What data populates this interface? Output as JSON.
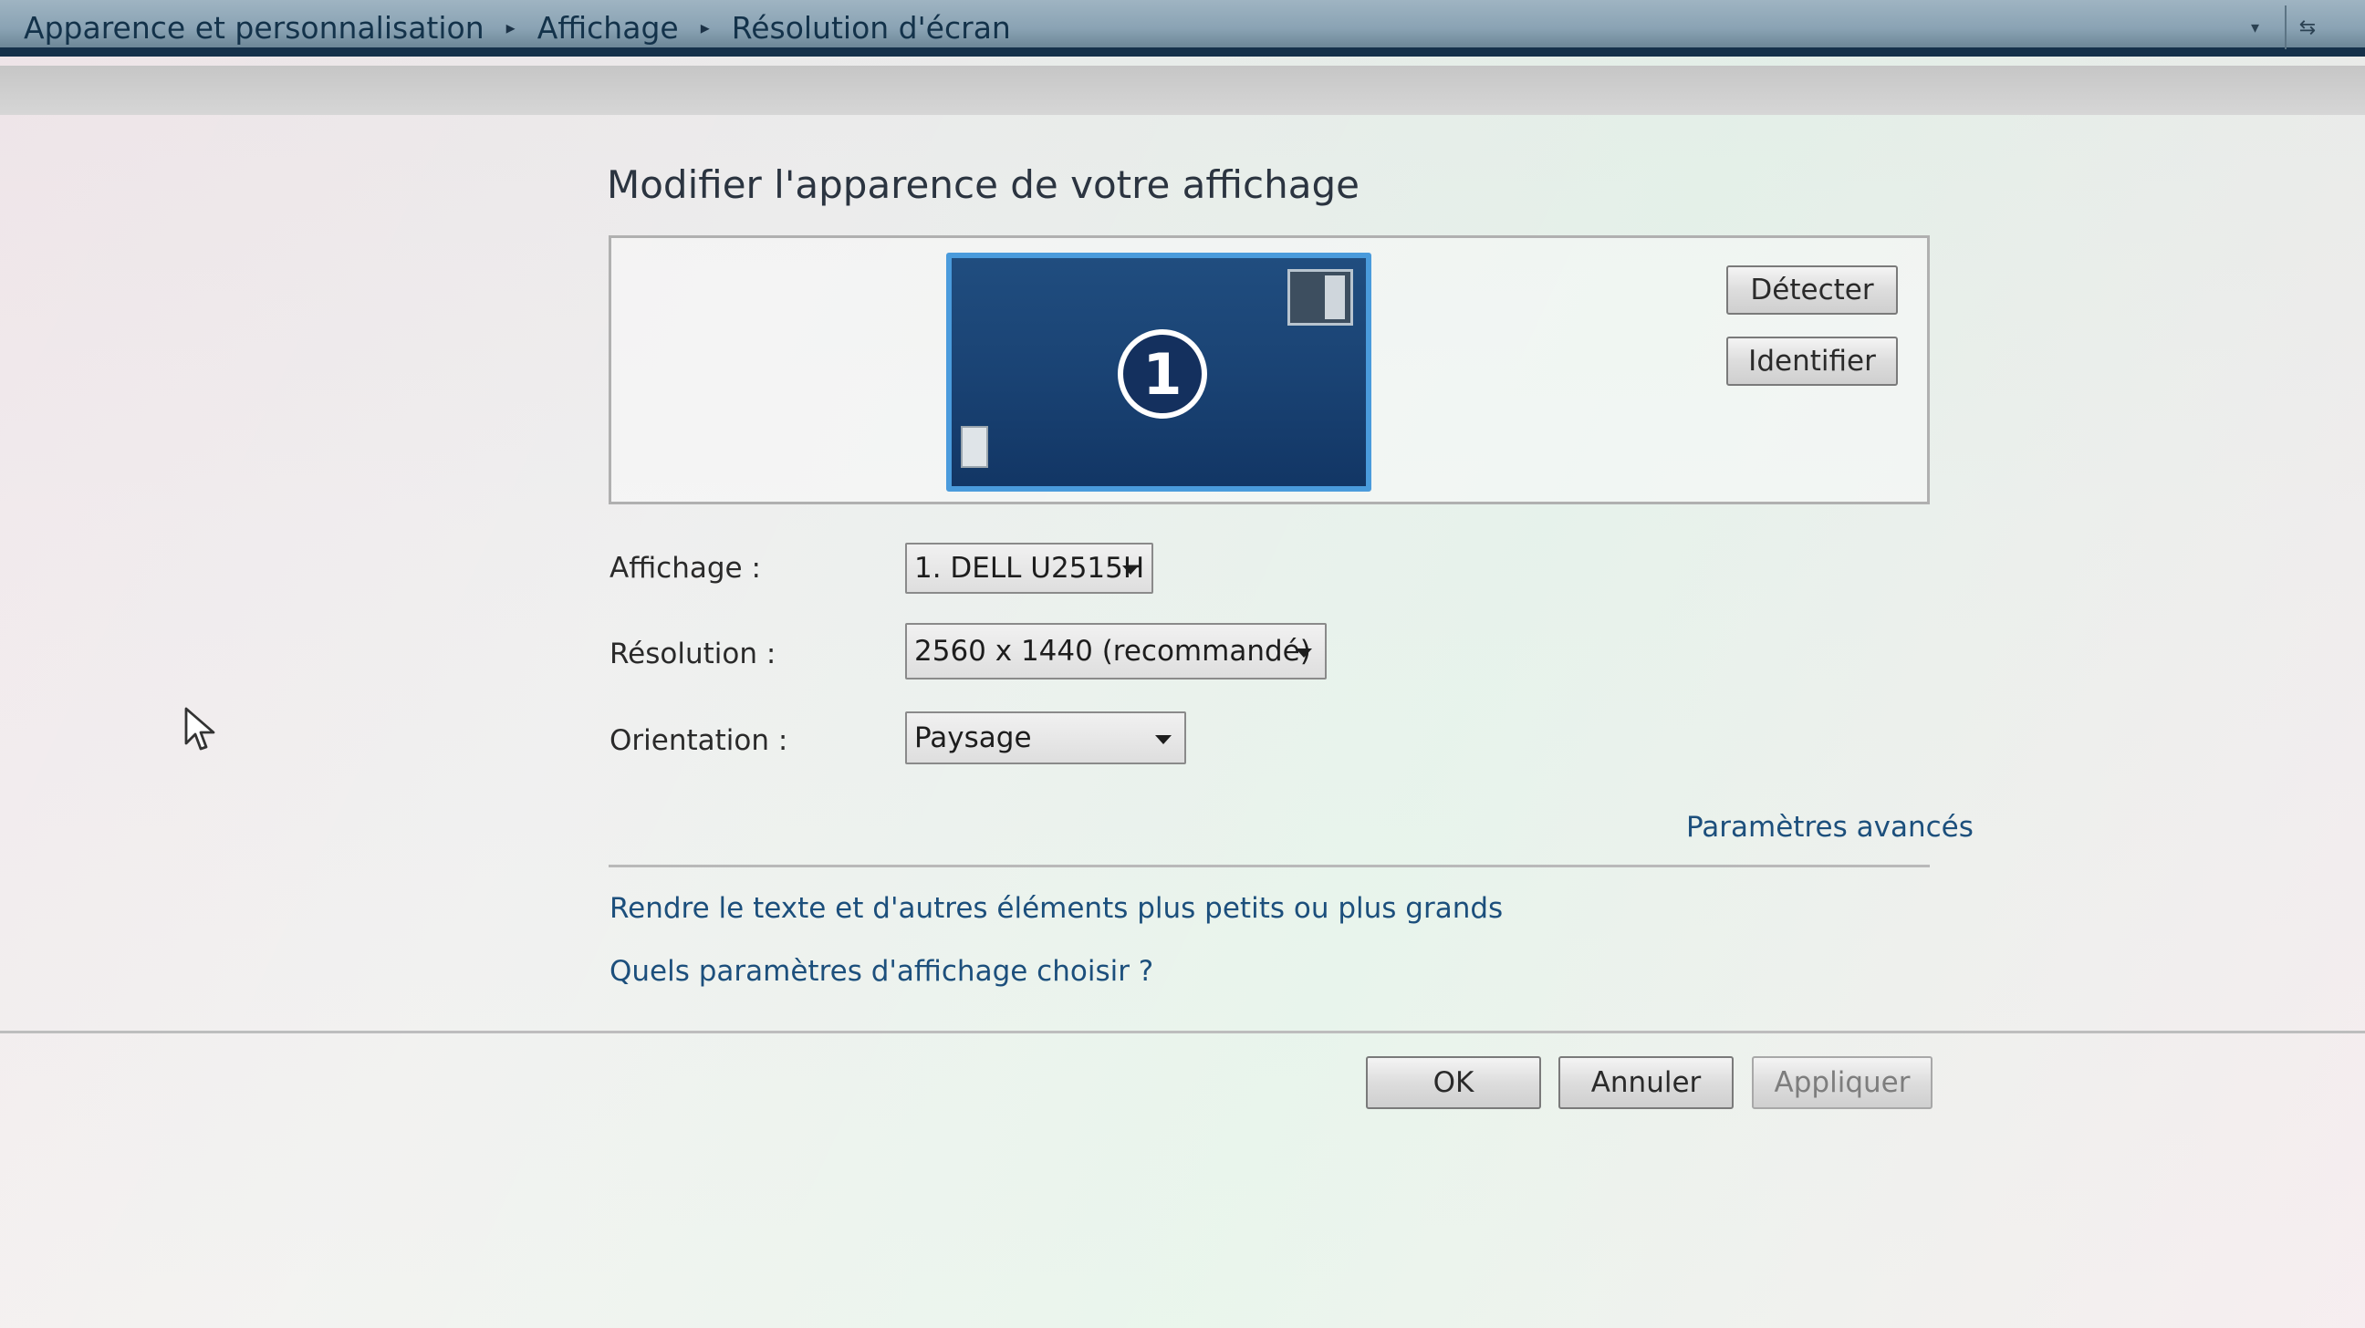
{
  "breadcrumb": {
    "items": [
      "Apparence et personnalisation",
      "Affichage",
      "Résolution d'écran"
    ],
    "separator": "▸"
  },
  "page": {
    "title": "Modifier l'apparence de votre affichage"
  },
  "preview": {
    "monitor_number": "1",
    "detect_label": "Détecter",
    "identify_label": "Identifier"
  },
  "fields": {
    "display_label": "Affichage :",
    "display_value": "1. DELL U2515H",
    "resolution_label": "Résolution :",
    "resolution_value": "2560 x 1440 (recommandé)",
    "orientation_label": "Orientation :",
    "orientation_value": "Paysage"
  },
  "links": {
    "advanced": "Paramètres avancés",
    "text_size": "Rendre le texte et d'autres éléments plus petits ou plus grands",
    "which_settings": "Quels paramètres d'affichage choisir ?"
  },
  "actions": {
    "ok": "OK",
    "cancel": "Annuler",
    "apply": "Appliquer"
  },
  "colors": {
    "monitor_fill": "#1a4374",
    "monitor_border": "#4a9bdc",
    "link": "#1c4f7c",
    "addressbar": "#8aa3b4"
  }
}
